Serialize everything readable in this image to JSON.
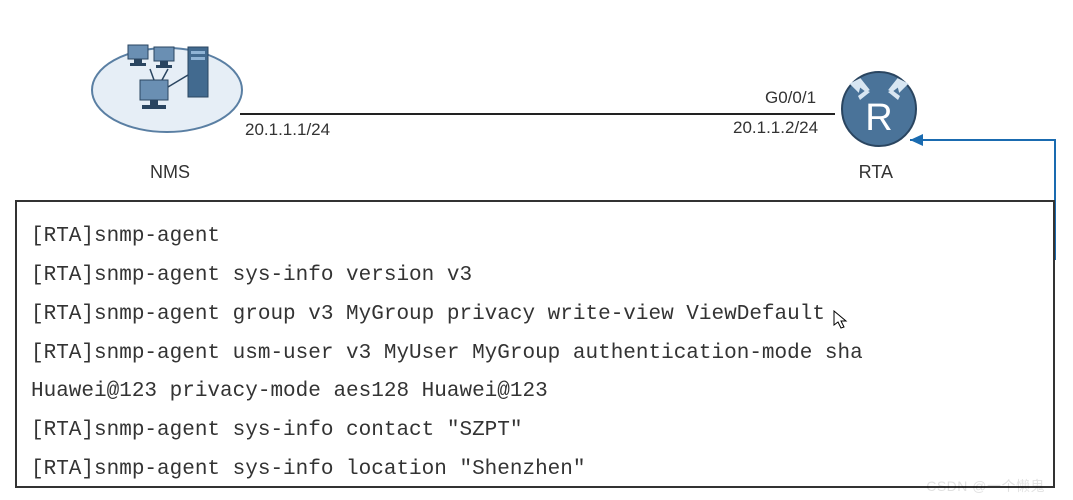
{
  "topology": {
    "left_device_label": "NMS",
    "right_device_label": "RTA",
    "left_ip": "20.1.1.1/24",
    "right_ip": "20.1.1.2/24",
    "right_interface": "G0/0/1",
    "router_letter": "R"
  },
  "config_lines": [
    "[RTA]snmp-agent",
    "[RTA]snmp-agent sys-info version v3",
    "[RTA]snmp-agent group v3 MyGroup privacy write-view ViewDefault",
    "[RTA]snmp-agent usm-user v3 MyUser MyGroup authentication-mode sha",
    "Huawei@123 privacy-mode aes128 Huawei@123",
    "[RTA]snmp-agent sys-info contact \"SZPT\"",
    "[RTA]snmp-agent sys-info location \"Shenzhen\""
  ],
  "watermark": "CSDN @一个懒鬼"
}
